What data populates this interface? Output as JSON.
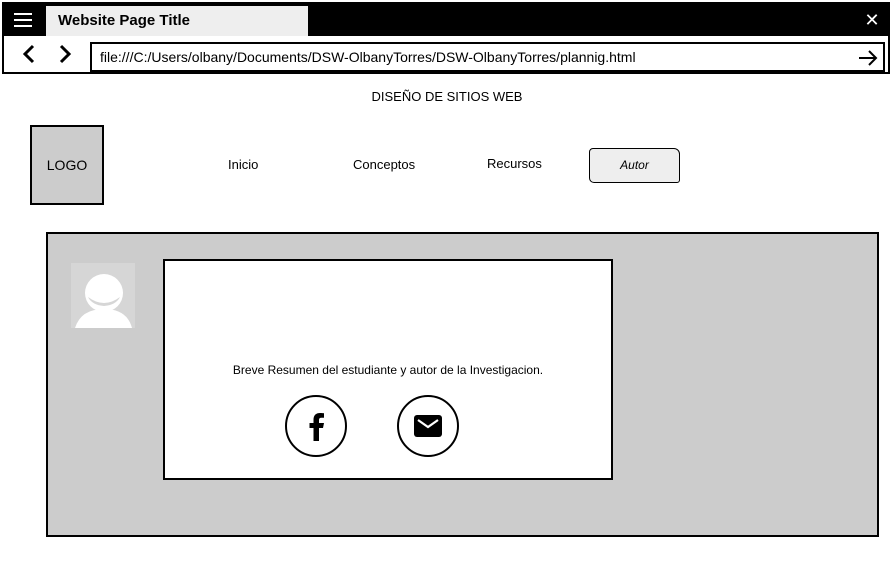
{
  "browser": {
    "tab_title": "Website Page Title",
    "url": "file:///C:/Users/olbany/Documents/DSW-OlbanyTorres/DSW-OlbanyTorres/plannig.html",
    "close_label": "✕"
  },
  "site": {
    "heading": "DISEÑO DE SITIOS WEB",
    "logo_label": "LOGO"
  },
  "nav": {
    "inicio": "Inicio",
    "conceptos": "Conceptos",
    "recursos": "Recursos",
    "autor": "Autor"
  },
  "author": {
    "summary": "Breve Resumen del estudiante y autor de la Investigacion."
  },
  "icons": {
    "menu": "menu-icon",
    "back": "chevron-left-icon",
    "forward": "chevron-right-icon",
    "go": "arrow-right-icon",
    "avatar": "user-avatar-icon",
    "facebook": "facebook-icon",
    "email": "email-icon"
  },
  "colors": {
    "titlebar": "#000000",
    "tab": "#eeeeee",
    "panel": "#cccccc",
    "card": "#ffffff"
  }
}
